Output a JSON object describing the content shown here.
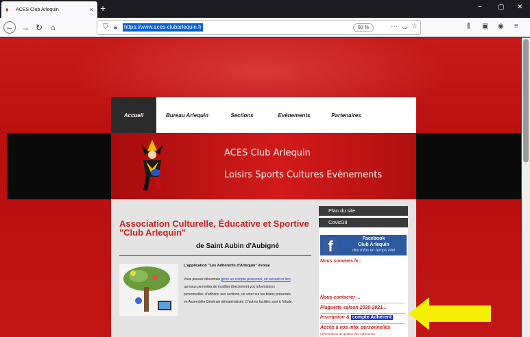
{
  "browser": {
    "tab_title": "ACES Club Arlequin",
    "tab_close": "×",
    "new_tab": "+",
    "url": "https://www.aces-clubarlequin.fr",
    "zoom": "80 %",
    "window_controls": [
      "−",
      "▢",
      "✕"
    ],
    "toolbar_icons": [
      "bookmarks-library-icon",
      "sidebar-icon",
      "account-icon",
      "menu-icon"
    ]
  },
  "nav": {
    "items": [
      {
        "label": "Accueil",
        "active": true
      },
      {
        "label": "Bureau Arlequin"
      },
      {
        "label": "Sections"
      },
      {
        "label": "Evénements"
      },
      {
        "label": "Partenaires"
      }
    ]
  },
  "banner": {
    "title": "ACES Club Arlequin",
    "subtitle": "Loisirs Sports Cultures Evènements"
  },
  "main": {
    "heading": "Association Culturelle, Éducative et Sportive \"Club Arlequin\"",
    "subheading": "de Saint Aubin d'Aubigné",
    "app_title": "L'application \"Les Adhérents d'Arlequin\" évolue",
    "app_text_1": "Vous pouvez désormais ",
    "app_link_1": "gérer un compte personnel",
    "app_text_2": ", ",
    "app_link_2": "en suivant ce lien",
    "app_text_3": ", qui vous permettra de modifier directement vos informations personnelles, d'adhérer aux sections, de voter sur les bilans présentés en Assemblée Générale dématérialisée. D'autres facilités sont à l'étude."
  },
  "sidebar": {
    "plan": "Plan du site",
    "covid": "Covid19",
    "facebook_l1": "Facebook",
    "facebook_l2": "Club Arlequin",
    "facebook_l3": "des infos en temps réel",
    "nous_sommes": "Nous sommes le :",
    "contact": "Nous contacter ...",
    "plaquette": "Plaquette saison 2020-2021...",
    "inscription": "Inscription & ",
    "compte": "compte Adhérent",
    "acces": "Accès à vos info. personnelles",
    "acces_small": "(Informations de gestion des Adhérents)"
  },
  "colors": {
    "brand_red": "#c81f1f",
    "highlight_blue": "#1b2fd0",
    "arrow_yellow": "#f5f000"
  }
}
